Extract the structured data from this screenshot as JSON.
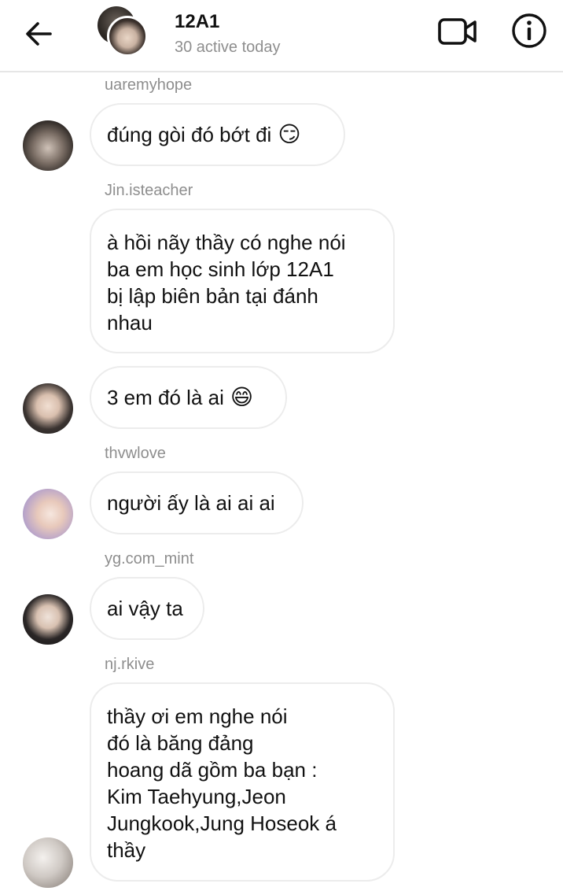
{
  "header": {
    "title": "12A1",
    "subtitle": "30 active today"
  },
  "icons": {
    "back": "arrow-left-icon",
    "video": "video-camera-icon",
    "info": "info-circle-icon"
  },
  "messages": [
    {
      "username": "uaremyhope",
      "text": "đúng gòi đó bớt đi",
      "emoji": "😏"
    },
    {
      "username": "Jin.isteacher",
      "lines": [
        "à hồi nãy thầy có nghe nói",
        "ba em học sinh lớp 12A1",
        "bị lập biên bản tại đánh",
        "nhau"
      ]
    },
    {
      "text": "3 em đó là ai",
      "emoji": "😄"
    },
    {
      "username": "thvwlove",
      "text": "người ấy là ai ai ai"
    },
    {
      "username": "yg.com_mint",
      "text": "ai vậy ta"
    },
    {
      "username": "nj.rkive",
      "lines": [
        "thầy ơi em nghe nói",
        "đó là băng đảng",
        "hoang dã gồm ba bạn :",
        "Kim Taehyung,Jeon",
        "Jungkook,Jung Hoseok á",
        "thầy"
      ]
    }
  ]
}
